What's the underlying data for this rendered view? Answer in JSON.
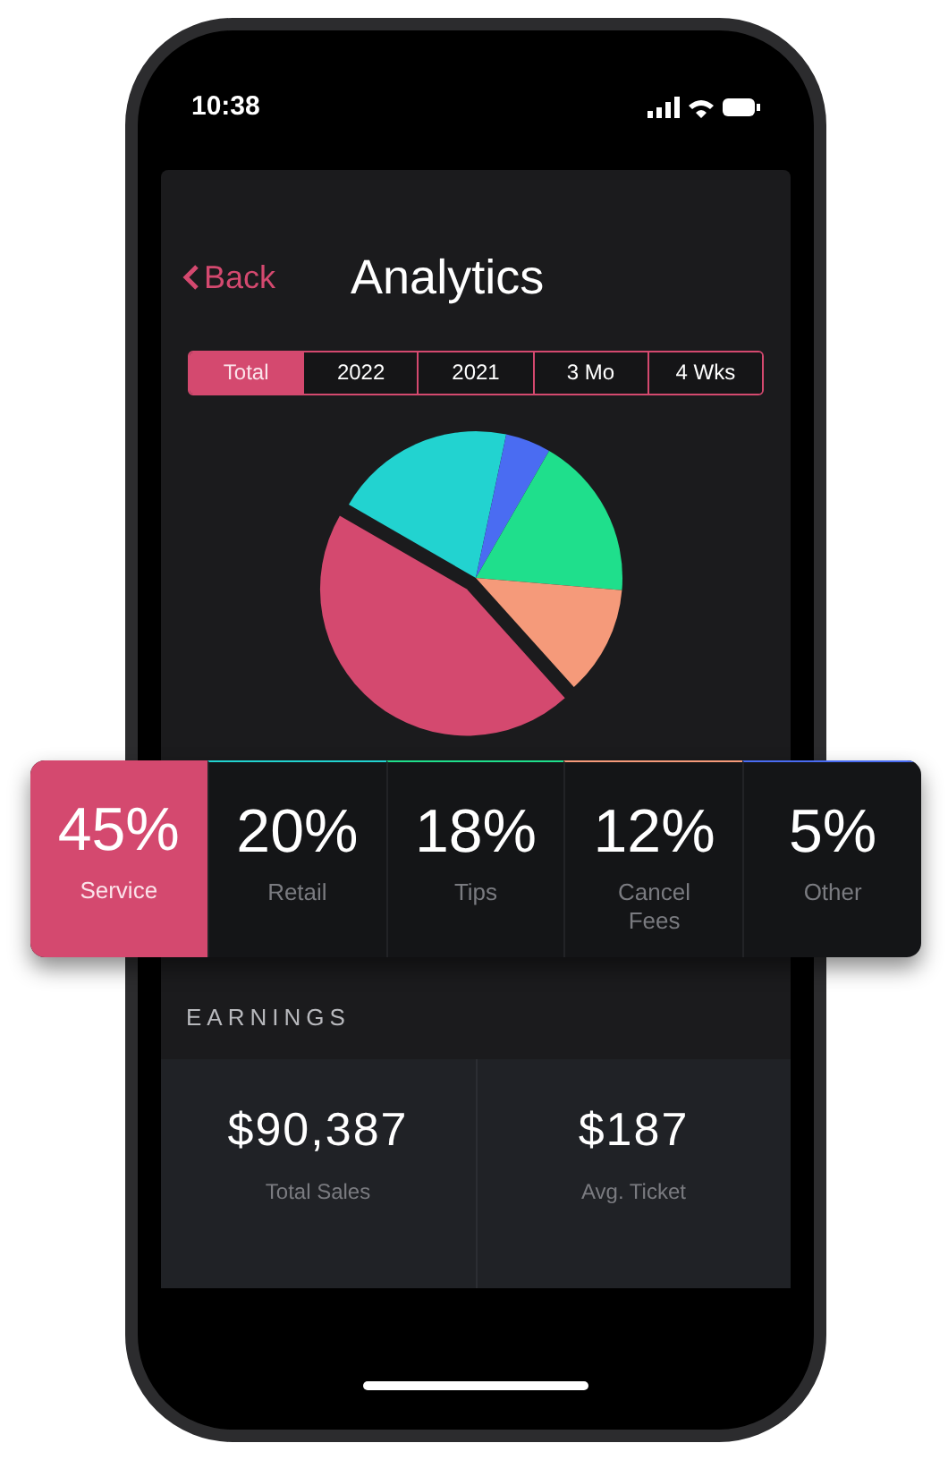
{
  "status_bar": {
    "time": "10:38"
  },
  "header": {
    "back": "Back",
    "title": "Analytics"
  },
  "periods": [
    {
      "label": "Total",
      "selected": true
    },
    {
      "label": "2022",
      "selected": false
    },
    {
      "label": "2021",
      "selected": false
    },
    {
      "label": "3 Mo",
      "selected": false
    },
    {
      "label": "4 Wks",
      "selected": false
    }
  ],
  "breakdown": {
    "stats": [
      {
        "value": "45%",
        "label": "Service",
        "color": "#d4496f",
        "selected": true
      },
      {
        "value": "20%",
        "label": "Retail",
        "color": "#22d3d0",
        "selected": false
      },
      {
        "value": "18%",
        "label": "Tips",
        "color": "#1fdf8c",
        "selected": false
      },
      {
        "value": "12%",
        "label": "Cancel Fees",
        "color": "#f59a7a",
        "selected": false
      },
      {
        "value": "5%",
        "label": "Other",
        "color": "#4a6cf2",
        "selected": false
      }
    ]
  },
  "earnings": {
    "title": "EARNINGS",
    "metrics": [
      {
        "value": "$90,387",
        "label": "Total Sales"
      },
      {
        "value": "$187",
        "label": "Avg. Ticket"
      }
    ]
  }
}
